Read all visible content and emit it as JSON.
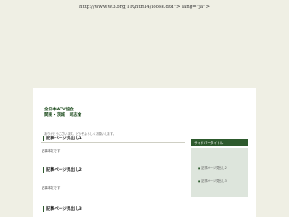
{
  "header": {
    "doctype_text": "http://www.w3.org/TR/html4/loose.dtd\"> lang=\"ja\">"
  },
  "site": {
    "title_lines": [
      "全日本ATV協会",
      "関東・茨城　同志會"
    ],
    "description": "ありがとうございます。どうぞよろしくお願いします。"
  },
  "posts": [
    {
      "title": "記事ページ見出し1",
      "body": "記事本文です"
    },
    {
      "title": "記事ページ見出し2",
      "body": "記事本文です"
    },
    {
      "title": "記事ページ見出し3",
      "body": ""
    }
  ],
  "sidebar": {
    "title": "サイドバータイトル",
    "links": [
      "記事ページ見出し2",
      "記事ページ見出し3"
    ]
  },
  "colors": {
    "background": "#efefe4",
    "accent_green": "#2d5a2d",
    "sidebar_box": "#dde5dc"
  }
}
